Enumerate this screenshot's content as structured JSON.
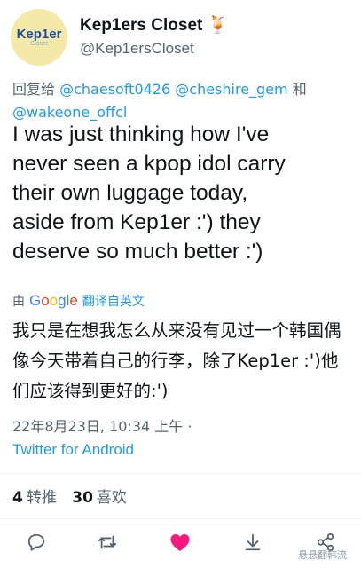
{
  "user": {
    "display_name": "Kep1ers Closet",
    "emoji": "🍹",
    "handle": "@Kep1ersCloset",
    "avatar_text": "Kep1er",
    "avatar_subtext": "Closet"
  },
  "reply": {
    "prefix": "回复给",
    "mention_1": "@chaesoft0426",
    "mention_2": "@cheshire_gem",
    "conjunction": "和",
    "mention_3": "@wakeone_offcl"
  },
  "tweet": {
    "text": "I was just thinking how I've\nnever seen a kpop idol carry\ntheir own luggage today,\naside from Kep1er :') they\ndeserve so much better :')"
  },
  "translation": {
    "by_label": "由",
    "provider": "Google",
    "action": "翻译自英文",
    "text": "我只是在想我怎么从来没有见过一个韩国偶像今天带着自己的行李，除了Kep1er :')他们应该得到更好的:')"
  },
  "meta": {
    "timestamp": "22年8月23日, 10:34 上午 ·",
    "source": "Twitter for Android"
  },
  "stats": {
    "retweets_count": "4",
    "retweets_label": "转推",
    "likes_count": "30",
    "likes_label": "喜欢"
  },
  "actions": {
    "reply_icon": "reply-icon",
    "retweet_icon": "retweet-icon",
    "like_icon": "heart-icon",
    "like_color": "#f91880",
    "bookmark_icon": "bookmark-icon",
    "share_icon": "share-icon"
  },
  "watermark": "悬悬翻韩流",
  "colors": {
    "accent": "#1d9bf0",
    "secondary_text": "#536471",
    "primary_text": "#0f1419"
  }
}
